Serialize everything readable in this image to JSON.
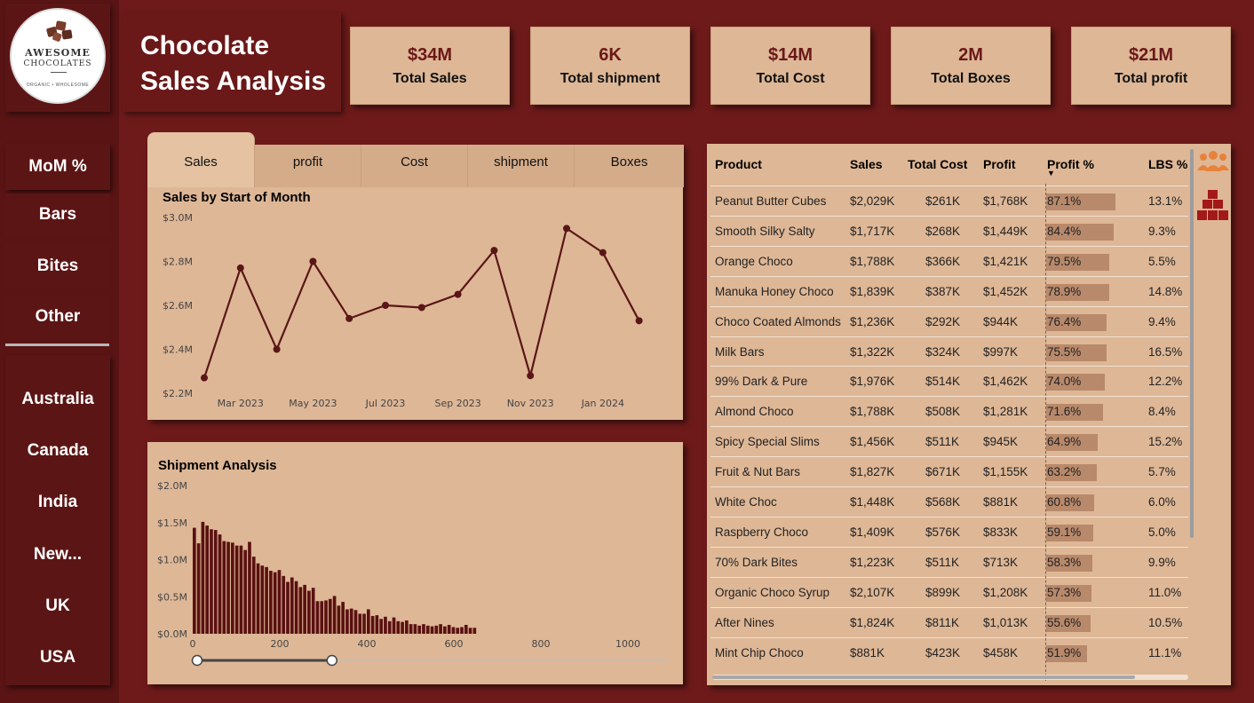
{
  "brand": {
    "logo_line1": "AWESOME",
    "logo_line2": "CHOCOLATES",
    "logo_line3": "ORGANIC • WHOLESOME"
  },
  "title": {
    "line1": "Chocolate",
    "line2": "Sales Analysis"
  },
  "categories": [
    "MoM %",
    "Bars",
    "Bites",
    "Other"
  ],
  "countries": [
    "Australia",
    "Canada",
    "India",
    "New...",
    "UK",
    "USA"
  ],
  "kpis": [
    {
      "value": "$34M",
      "label": "Total Sales"
    },
    {
      "value": "6K",
      "label": "Total shipment"
    },
    {
      "value": "$14M",
      "label": "Total Cost"
    },
    {
      "value": "2M",
      "label": "Total Boxes"
    },
    {
      "value": "$21M",
      "label": "Total profit"
    }
  ],
  "tabs": [
    "Sales",
    "profit",
    "Cost",
    "shipment",
    "Boxes"
  ],
  "colors": {
    "background": "#6e1a1a",
    "card": "#deb796",
    "accent": "#6a1818",
    "line": "#5a1616",
    "bar": "#5a1111",
    "profit_bar": "#b8896b"
  },
  "chart_data": [
    {
      "type": "line",
      "title": "Sales by Start of Month",
      "x": [
        "2023-02",
        "2023-03",
        "2023-04",
        "2023-05",
        "2023-06",
        "2023-07",
        "2023-08",
        "2023-09",
        "2023-10",
        "2023-11",
        "2023-12",
        "2024-01",
        "2024-02"
      ],
      "x_tick_labels": [
        "Mar 2023",
        "May 2023",
        "Jul 2023",
        "Sep 2023",
        "Nov 2023",
        "Jan 2024"
      ],
      "x_tick_positions": [
        "2023-03",
        "2023-05",
        "2023-07",
        "2023-09",
        "2023-11",
        "2024-01"
      ],
      "values": [
        2.27,
        2.77,
        2.4,
        2.8,
        2.54,
        2.6,
        2.59,
        2.65,
        2.85,
        2.28,
        2.95,
        2.84,
        2.53
      ],
      "unit": "$M",
      "y_tick_labels": [
        "$2.2M",
        "$2.4M",
        "$2.6M",
        "$2.8M",
        "$3.0M"
      ],
      "ylim": [
        2.2,
        3.0
      ]
    },
    {
      "type": "bar",
      "title": "Shipment Analysis",
      "x_start": 0,
      "bin_width": 20,
      "values": [
        1.43,
        1.22,
        1.51,
        1.46,
        1.41,
        1.4,
        1.34,
        1.25,
        1.24,
        1.23,
        1.19,
        1.19,
        1.13,
        1.24,
        1.04,
        0.95,
        0.92,
        0.9,
        0.85,
        0.83,
        0.86,
        0.78,
        0.7,
        0.76,
        0.71,
        0.63,
        0.66,
        0.58,
        0.62,
        0.44,
        0.44,
        0.45,
        0.47,
        0.51,
        0.38,
        0.43,
        0.33,
        0.34,
        0.32,
        0.27,
        0.27,
        0.33,
        0.24,
        0.25,
        0.2,
        0.23,
        0.17,
        0.22,
        0.17,
        0.16,
        0.18,
        0.13,
        0.13,
        0.11,
        0.13,
        0.11,
        0.1,
        0.11,
        0.13,
        0.1,
        0.12,
        0.09,
        0.08,
        0.09,
        0.12,
        0.08,
        0.08
      ],
      "unit": "$M",
      "x_tick_labels": [
        "0",
        "200",
        "400",
        "600",
        "800",
        "1000"
      ],
      "x_tick_values": [
        0,
        200,
        400,
        600,
        800,
        1000
      ],
      "y_tick_labels": [
        "$0.0M",
        "$0.5M",
        "$1.0M",
        "$1.5M",
        "$2.0M"
      ],
      "ylim": [
        0,
        2.0
      ],
      "xlim": [
        0,
        1100
      ],
      "slider_range": [
        0,
        350
      ]
    }
  ],
  "table": {
    "columns": [
      "Product",
      "Sales",
      "Total Cost",
      "Profit",
      "Profit %",
      "LBS %"
    ],
    "sort_indicator": "▼",
    "rows": [
      {
        "product": "Peanut Butter Cubes",
        "sales": "$2,029K",
        "cost": "$261K",
        "profit": "$1,768K",
        "pct": "87.1%",
        "pct_value": 87.1,
        "lbs": "13.1%"
      },
      {
        "product": "Smooth Silky Salty",
        "sales": "$1,717K",
        "cost": "$268K",
        "profit": "$1,449K",
        "pct": "84.4%",
        "pct_value": 84.4,
        "lbs": "9.3%"
      },
      {
        "product": "Orange Choco",
        "sales": "$1,788K",
        "cost": "$366K",
        "profit": "$1,421K",
        "pct": "79.5%",
        "pct_value": 79.5,
        "lbs": "5.5%"
      },
      {
        "product": "Manuka Honey Choco",
        "sales": "$1,839K",
        "cost": "$387K",
        "profit": "$1,452K",
        "pct": "78.9%",
        "pct_value": 78.9,
        "lbs": "14.8%"
      },
      {
        "product": "Choco Coated Almonds",
        "sales": "$1,236K",
        "cost": "$292K",
        "profit": "$944K",
        "pct": "76.4%",
        "pct_value": 76.4,
        "lbs": "9.4%"
      },
      {
        "product": "Milk Bars",
        "sales": "$1,322K",
        "cost": "$324K",
        "profit": "$997K",
        "pct": "75.5%",
        "pct_value": 75.5,
        "lbs": "16.5%"
      },
      {
        "product": "99% Dark & Pure",
        "sales": "$1,976K",
        "cost": "$514K",
        "profit": "$1,462K",
        "pct": "74.0%",
        "pct_value": 74.0,
        "lbs": "12.2%"
      },
      {
        "product": "Almond Choco",
        "sales": "$1,788K",
        "cost": "$508K",
        "profit": "$1,281K",
        "pct": "71.6%",
        "pct_value": 71.6,
        "lbs": "8.4%"
      },
      {
        "product": "Spicy Special Slims",
        "sales": "$1,456K",
        "cost": "$511K",
        "profit": "$945K",
        "pct": "64.9%",
        "pct_value": 64.9,
        "lbs": "15.2%"
      },
      {
        "product": "Fruit & Nut Bars",
        "sales": "$1,827K",
        "cost": "$671K",
        "profit": "$1,155K",
        "pct": "63.2%",
        "pct_value": 63.2,
        "lbs": "5.7%"
      },
      {
        "product": "White Choc",
        "sales": "$1,448K",
        "cost": "$568K",
        "profit": "$881K",
        "pct": "60.8%",
        "pct_value": 60.8,
        "lbs": "6.0%"
      },
      {
        "product": "Raspberry Choco",
        "sales": "$1,409K",
        "cost": "$576K",
        "profit": "$833K",
        "pct": "59.1%",
        "pct_value": 59.1,
        "lbs": "5.0%"
      },
      {
        "product": "70% Dark Bites",
        "sales": "$1,223K",
        "cost": "$511K",
        "profit": "$713K",
        "pct": "58.3%",
        "pct_value": 58.3,
        "lbs": "9.9%"
      },
      {
        "product": "Organic Choco Syrup",
        "sales": "$2,107K",
        "cost": "$899K",
        "profit": "$1,208K",
        "pct": "57.3%",
        "pct_value": 57.3,
        "lbs": "11.0%"
      },
      {
        "product": "After Nines",
        "sales": "$1,824K",
        "cost": "$811K",
        "profit": "$1,013K",
        "pct": "55.6%",
        "pct_value": 55.6,
        "lbs": "10.5%"
      },
      {
        "product": "Mint Chip Choco",
        "sales": "$881K",
        "cost": "$423K",
        "profit": "$458K",
        "pct": "51.9%",
        "pct_value": 51.9,
        "lbs": "11.1%"
      }
    ]
  },
  "side_icons": [
    "people-icon",
    "boxes-icon"
  ]
}
